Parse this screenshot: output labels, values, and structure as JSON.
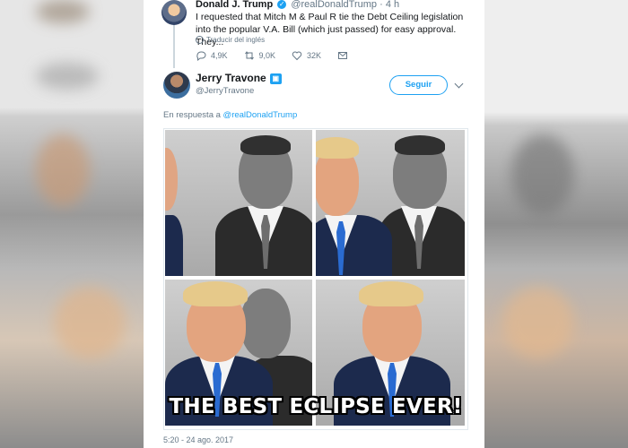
{
  "original_tweet": {
    "author_name": "Donald J. Trump",
    "handle": "@realDonaldTrump",
    "time_ago": "· 4 h",
    "text": "I requested that Mitch M & Paul R tie the Debt Ceiling legislation into the popular V.A. Bill (which just passed) for easy approval. They...",
    "translate_label": "Traducir del inglés",
    "counts": {
      "replies": "4,9K",
      "retweets": "9,0K",
      "likes": "32K"
    }
  },
  "reply_tweet": {
    "author_name": "Jerry Travone",
    "handle": "@JerryTravone",
    "follow_label": "Seguir",
    "reply_prefix": "En respuesta a",
    "reply_mention": "@realDonaldTrump",
    "meme_caption": "THE BEST ECLIPSE EVER!",
    "timestamp": "5:20 - 24 ago. 2017"
  },
  "colors": {
    "accent": "#1da1f2",
    "muted": "#657786",
    "text": "#14171a"
  },
  "icons": [
    "reply-icon",
    "retweet-icon",
    "like-icon",
    "message-icon",
    "verified-icon",
    "globe-icon",
    "chevron-down-icon"
  ]
}
